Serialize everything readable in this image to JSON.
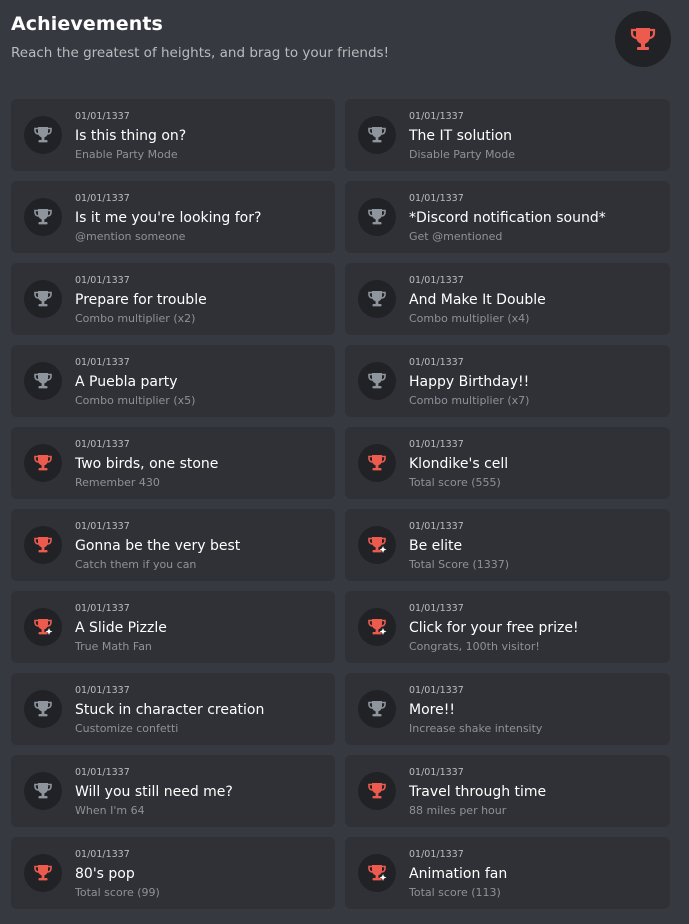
{
  "header": {
    "title": "Achievements",
    "subtitle": "Reach the greatest of heights, and brag to your friends!",
    "badge_icon": "trophy-icon",
    "badge_color": "#ed5b4f"
  },
  "colors": {
    "background": "#36393f",
    "card": "#2f3136",
    "badge_bg": "#202225",
    "locked_trophy": "#8e959d",
    "unlocked_trophy": "#ed5b4f"
  },
  "achievements": [
    {
      "date": "01/01/1337",
      "name": "Is this thing on?",
      "description": "Enable Party Mode",
      "unlocked": false,
      "sparkle": false
    },
    {
      "date": "01/01/1337",
      "name": "The IT solution",
      "description": "Disable Party Mode",
      "unlocked": false,
      "sparkle": false
    },
    {
      "date": "01/01/1337",
      "name": "Is it me you're looking for?",
      "description": "@mention someone",
      "unlocked": false,
      "sparkle": false
    },
    {
      "date": "01/01/1337",
      "name": "*Discord notification sound*",
      "description": "Get @mentioned",
      "unlocked": false,
      "sparkle": false
    },
    {
      "date": "01/01/1337",
      "name": "Prepare for trouble",
      "description": "Combo multiplier (x2)",
      "unlocked": false,
      "sparkle": false
    },
    {
      "date": "01/01/1337",
      "name": "And Make It Double",
      "description": "Combo multiplier (x4)",
      "unlocked": false,
      "sparkle": false
    },
    {
      "date": "01/01/1337",
      "name": "A Puebla party",
      "description": "Combo multiplier (x5)",
      "unlocked": false,
      "sparkle": false
    },
    {
      "date": "01/01/1337",
      "name": "Happy Birthday!!",
      "description": "Combo multiplier (x7)",
      "unlocked": false,
      "sparkle": false
    },
    {
      "date": "01/01/1337",
      "name": "Two birds, one stone",
      "description": "Remember 430",
      "unlocked": true,
      "sparkle": false
    },
    {
      "date": "01/01/1337",
      "name": "Klondike's cell",
      "description": "Total score (555)",
      "unlocked": true,
      "sparkle": false
    },
    {
      "date": "01/01/1337",
      "name": "Gonna be the very best",
      "description": "Catch them if you can",
      "unlocked": true,
      "sparkle": false
    },
    {
      "date": "01/01/1337",
      "name": "Be elite",
      "description": "Total Score (1337)",
      "unlocked": true,
      "sparkle": true
    },
    {
      "date": "01/01/1337",
      "name": "A Slide Pizzle",
      "description": "True Math Fan",
      "unlocked": true,
      "sparkle": true
    },
    {
      "date": "01/01/1337",
      "name": "Click for your free prize!",
      "description": "Congrats, 100th visitor!",
      "unlocked": true,
      "sparkle": true
    },
    {
      "date": "01/01/1337",
      "name": "Stuck in character creation",
      "description": "Customize confetti",
      "unlocked": false,
      "sparkle": false
    },
    {
      "date": "01/01/1337",
      "name": "More!!",
      "description": "Increase shake intensity",
      "unlocked": false,
      "sparkle": false
    },
    {
      "date": "01/01/1337",
      "name": "Will you still need me?",
      "description": "When I'm 64",
      "unlocked": false,
      "sparkle": false
    },
    {
      "date": "01/01/1337",
      "name": "Travel through time",
      "description": "88 miles per hour",
      "unlocked": true,
      "sparkle": false
    },
    {
      "date": "01/01/1337",
      "name": "80's pop",
      "description": "Total score (99)",
      "unlocked": true,
      "sparkle": false
    },
    {
      "date": "01/01/1337",
      "name": "Animation fan",
      "description": "Total score (113)",
      "unlocked": true,
      "sparkle": true
    }
  ]
}
